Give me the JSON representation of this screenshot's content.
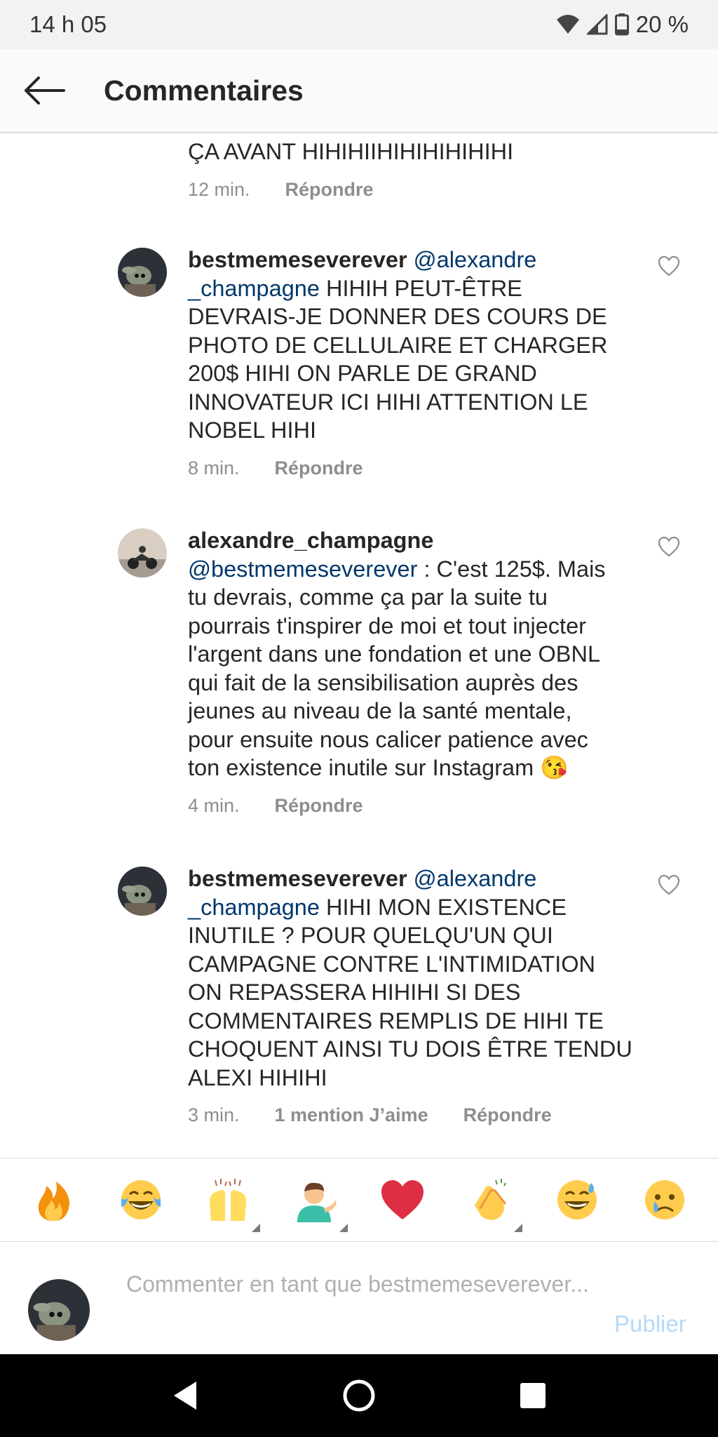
{
  "status_bar": {
    "time": "14 h 05",
    "battery": "20 %",
    "icons": [
      "wifi-icon",
      "signal-icon",
      "battery-icon"
    ]
  },
  "header": {
    "back_icon": "arrow-left-icon",
    "title": "Commentaires"
  },
  "partial_comment": {
    "text": "ÇA AVANT HIHIHIIHIHIHIHIHIHI",
    "time": "12 min.",
    "reply": "Répondre"
  },
  "comments": [
    {
      "username": "bestmemeseverever",
      "mention": "@alexandre",
      "mention_cont": "_champagne",
      "text_first": " HIHIH PEUT-ÊTRE",
      "lines": [
        "DEVRAIS-JE DONNER DES COURS DE",
        "PHOTO DE CELLULAIRE ET CHARGER",
        "200$ HIHI ON PARLE DE GRAND",
        "INNOVATEUR ICI HIHI ATTENTION LE",
        "NOBEL HIHI"
      ],
      "time": "8 min.",
      "reply": "Répondre"
    },
    {
      "username": "alexandre_champagne",
      "mention": "@bestmemeseverever",
      "text_first": " : C'est 125$. Mais",
      "lines": [
        "tu devrais, comme ça par la suite tu",
        "pourrais t'inspirer de moi et tout injecter",
        "l'argent dans une fondation et une OBNL",
        "qui fait de la sensibilisation auprès des",
        "jeunes au niveau de la santé mentale,",
        "pour ensuite nous calicer patience avec",
        "ton existence inutile sur Instagram"
      ],
      "emoji": "😘",
      "time": "4 min.",
      "reply": "Répondre"
    },
    {
      "username": "bestmemeseverever",
      "mention": "@alexandre",
      "mention_cont": "_champagne",
      "text_first": " HIHI MON EXISTENCE",
      "lines": [
        "INUTILE ? POUR QUELQU'UN QUI",
        "CAMPAGNE CONTRE L'INTIMIDATION",
        "ON REPASSERA HIHIHI SI DES",
        "COMMENTAIRES REMPLIS DE HIHI TE",
        "CHOQUENT AINSI TU DOIS ÊTRE TENDU",
        "ALEXI HIHIHI"
      ],
      "time": "3 min.",
      "likes": "1 mention J’aime",
      "reply": "Répondre"
    }
  ],
  "emoji_bar": [
    "🔥",
    "😂",
    "🙌",
    "💁‍♂️",
    "❤️",
    "👏",
    "😅",
    "😢"
  ],
  "input": {
    "placeholder": "Commenter en tant que bestmemeseverever...",
    "publish": "Publier"
  },
  "nav": [
    "back-triangle-icon",
    "home-circle-icon",
    "recents-square-icon"
  ]
}
